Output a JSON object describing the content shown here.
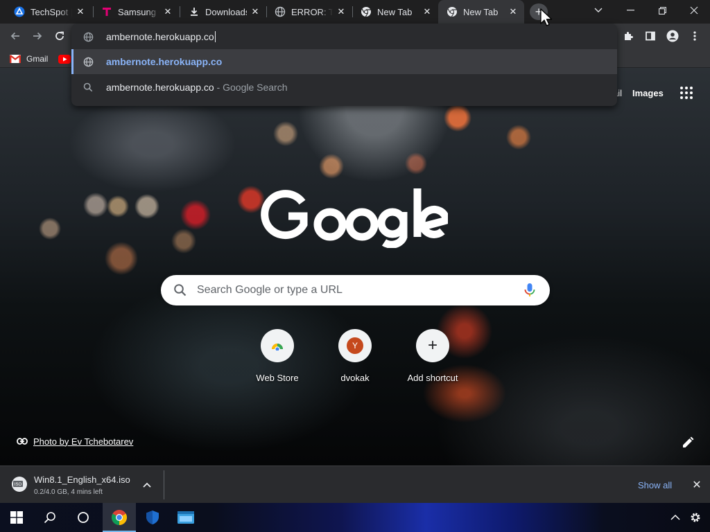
{
  "tabs": [
    {
      "title": "TechSpot | T",
      "icon": "techspot-icon"
    },
    {
      "title": "Samsung G",
      "icon": "tmobile-icon"
    },
    {
      "title": "Downloads",
      "icon": "download-icon"
    },
    {
      "title": "ERROR: The",
      "icon": "globe-icon"
    },
    {
      "title": "New Tab",
      "icon": "chrome-icon"
    },
    {
      "title": "New Tab",
      "icon": "chrome-icon",
      "active": true
    }
  ],
  "tab_close_glyph": "✕",
  "new_tab_glyph": "+",
  "omnibox": {
    "input_value": "ambernote.herokuapp.co",
    "suggestions": [
      {
        "text": "ambernote.herokuapp.co",
        "suffix": "",
        "icon": "globe-icon"
      },
      {
        "text": "ambernote.herokuapp.co",
        "suffix": " - Google Search",
        "icon": "search-icon"
      }
    ]
  },
  "bookmarks": [
    {
      "label": "Gmail",
      "icon": "gmail-icon"
    },
    {
      "label": "",
      "icon": "youtube-icon"
    }
  ],
  "ntp": {
    "top_links": [
      "ail",
      "Images"
    ],
    "search_placeholder": "Search Google or type a URL",
    "shortcuts": [
      {
        "label": "Web Store",
        "icon": "web-store-icon"
      },
      {
        "label": "dvokak",
        "icon": "avatar-y-icon",
        "letter": "Y"
      },
      {
        "label": "Add shortcut",
        "icon": "plus-icon",
        "glyph": "+"
      }
    ],
    "photo_credit": "Photo by Ev Tchebotarev"
  },
  "download": {
    "filename": "Win8.1_English_x64.iso",
    "status": "0.2/4.0 GB, 4 mins left",
    "show_all": "Show all",
    "close_glyph": "✕",
    "file_badge": "ISO"
  },
  "colors": {
    "accent_blue": "#8ab4f8",
    "toolbar": "#353639",
    "tabstrip": "#1f1f20"
  }
}
